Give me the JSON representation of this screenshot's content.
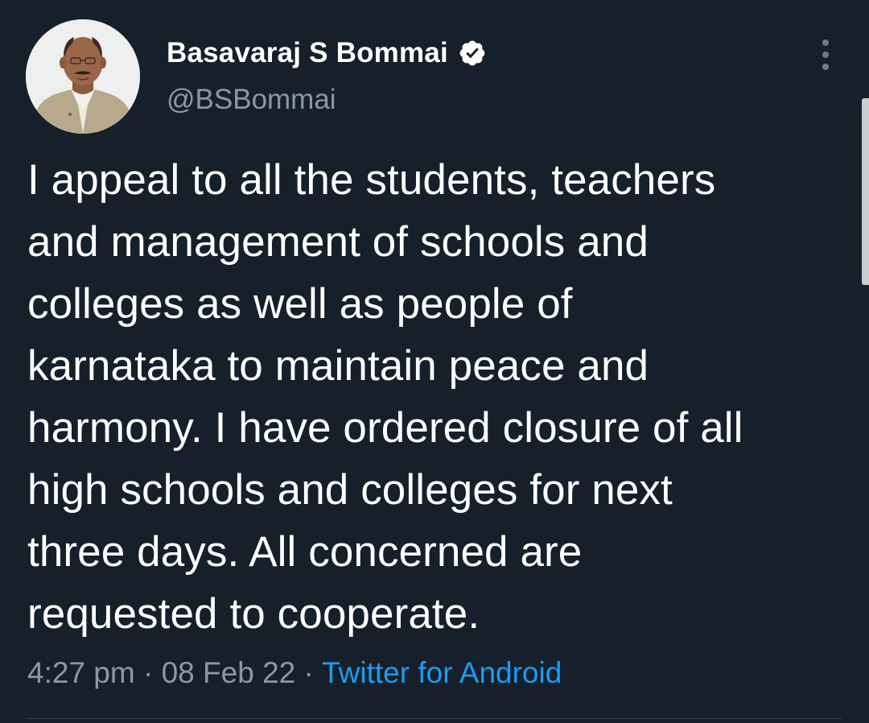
{
  "tweet": {
    "author": {
      "display_name": "Basavaraj S Bommai",
      "handle": "@BSBommai",
      "verified_icon": "verified-badge-icon"
    },
    "text": "I appeal to all the students,  teachers\nand management of schools and\ncolleges as well as people of\nkarnataka to maintain peace and\nharmony. I have ordered closure of all\nhigh schools and colleges for next\nthree days. All   concerned are\nrequested to cooperate.",
    "meta": {
      "time": "4:27 pm",
      "separator": " · ",
      "date": "08 Feb 22",
      "source": "Twitter for Android"
    }
  },
  "icons": {
    "more": "more-vertical-icon"
  },
  "colors": {
    "background": "#16202b",
    "text": "#ffffff",
    "secondary_text": "#8b98a5",
    "link": "#1d9bf0",
    "divider": "#38444d"
  }
}
